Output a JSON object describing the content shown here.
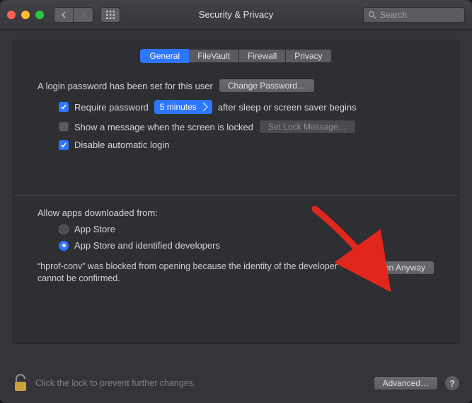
{
  "window": {
    "title": "Security & Privacy"
  },
  "search": {
    "placeholder": "Search"
  },
  "tabs": [
    "General",
    "FileVault",
    "Firewall",
    "Privacy"
  ],
  "active_tab": 0,
  "login": {
    "status_text": "A login password has been set for this user",
    "change_password_label": "Change Password…",
    "require_password": {
      "checked": true,
      "label": "Require password",
      "delay_selected": "5 minutes",
      "suffix": "after sleep or screen saver begins"
    },
    "show_message": {
      "checked": false,
      "label": "Show a message when the screen is locked",
      "set_button_label": "Set Lock Message…",
      "set_button_enabled": false
    },
    "disable_auto_login": {
      "checked": true,
      "label": "Disable automatic login"
    }
  },
  "gatekeeper": {
    "heading": "Allow apps downloaded from:",
    "options": [
      {
        "label": "App Store",
        "selected": false
      },
      {
        "label": "App Store and identified developers",
        "selected": true
      }
    ],
    "blocked_message": "“hprof-conv” was blocked from opening because the identity of the developer cannot be confirmed.",
    "open_anyway_label": "Open Anyway"
  },
  "footer": {
    "lock_hint": "Click the lock to prevent further changes.",
    "advanced_label": "Advanced…",
    "help_label": "?"
  }
}
